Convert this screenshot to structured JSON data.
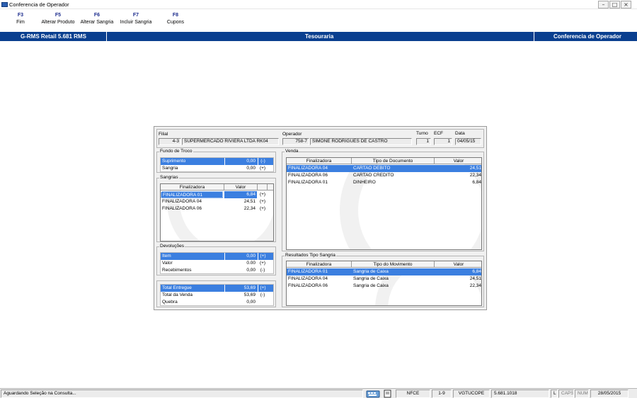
{
  "window": {
    "title": "Conferencia de Operador"
  },
  "fkeys": [
    {
      "key": "F3",
      "label": "Fim"
    },
    {
      "key": "F5",
      "label": "Alterar Produto"
    },
    {
      "key": "F6",
      "label": "Alterar Sangria"
    },
    {
      "key": "F7",
      "label": "Incluir Sangria"
    },
    {
      "key": "F8",
      "label": "Cupons"
    }
  ],
  "header": {
    "app": "G-RMS Retail 5.681 RMS",
    "section": "Tesouraria",
    "screen": "Conferencia de Operador"
  },
  "top": {
    "filial_label": "Filial",
    "filial_code": "4-3",
    "filial_name": "SUPERMERCADO RIVIERA LTDA RK04",
    "operador_label": "Operador",
    "operador_code": "758-7",
    "operador_name": "SIMONE RODRIGUES DE CASTRO",
    "turno_label": "Turno",
    "turno": "1",
    "ecf_label": "ECF",
    "ecf": "1",
    "data_label": "Data",
    "data": "04/05/15"
  },
  "fundo": {
    "title": "Fundo de Troco",
    "rows": [
      {
        "label": "Suprimento",
        "value": "0,00",
        "sign": "(-)"
      },
      {
        "label": "Sangria",
        "value": "0,00",
        "sign": "(+)"
      }
    ]
  },
  "sangrias": {
    "title": "Sangrias",
    "headers": [
      "Finalizadora",
      "Valor"
    ],
    "rows": [
      {
        "fin": "FINALIZADORA 01",
        "valor": "6,84",
        "sign": "(+)"
      },
      {
        "fin": "FINALIZADORA 04",
        "valor": "24,51",
        "sign": "(+)"
      },
      {
        "fin": "FINALIZADORA 06",
        "valor": "22,34",
        "sign": "(+)"
      }
    ]
  },
  "devolucoes": {
    "title": "Devoluções",
    "rows": [
      {
        "label": "Item",
        "value": "0,00",
        "sign": "(+)"
      },
      {
        "label": "Valor",
        "value": "0.00",
        "sign": "(+)"
      },
      {
        "label": "Recebimentos",
        "value": "0,00",
        "sign": "(-)"
      }
    ]
  },
  "totais": {
    "rows": [
      {
        "label": "Total Entregue",
        "value": "53,69",
        "sign": "(+)"
      },
      {
        "label": "Total da Venda",
        "value": "53,69",
        "sign": "(-)"
      },
      {
        "label": "Quebra",
        "value": "0,00",
        "sign": ""
      }
    ]
  },
  "venda": {
    "title": "Venda",
    "headers": [
      "Finalizadora",
      "Tipo de Documento",
      "Valor"
    ],
    "rows": [
      {
        "fin": "FINALIZADORA 04",
        "tipo": "CARTAO DEBITO",
        "valor": "24,51"
      },
      {
        "fin": "FINALIZADORA 06",
        "tipo": "CARTAO CREDITO",
        "valor": "22,34"
      },
      {
        "fin": "FINALIZADORA 01",
        "tipo": "DINHEIRO",
        "valor": "6,84"
      }
    ]
  },
  "resultados": {
    "title": "Resultados Tipo Sangria",
    "headers": [
      "Finalizadora",
      "Tipo do Movimento",
      "Valor"
    ],
    "rows": [
      {
        "fin": "FINALIZADORA 01",
        "tipo": "Sangria de Caixa",
        "valor": "6,84"
      },
      {
        "fin": "FINALIZADORA 04",
        "tipo": "Sangria de Caixa",
        "valor": "24,51"
      },
      {
        "fin": "FINALIZADORA 06",
        "tipo": "Sangria de Caixa",
        "valor": "22,34"
      }
    ]
  },
  "status": {
    "message": "Aguardando Seleção na Consulta...",
    "mode": "NFCE",
    "loja": "1-9",
    "user": "VGTUCOPE",
    "version": "5.681.1018",
    "l": "L",
    "caps": "CAPS",
    "num": "NUM",
    "date": "28/05/2015"
  },
  "colors": {
    "header_bg": "#0a3f8f",
    "selection": "#3b7fe0",
    "fkey": "#1a2a8c"
  },
  "icons": [
    "app-icon",
    "minimize-icon",
    "maximize-icon",
    "close-icon",
    "keyboard-icon",
    "document-icon"
  ]
}
